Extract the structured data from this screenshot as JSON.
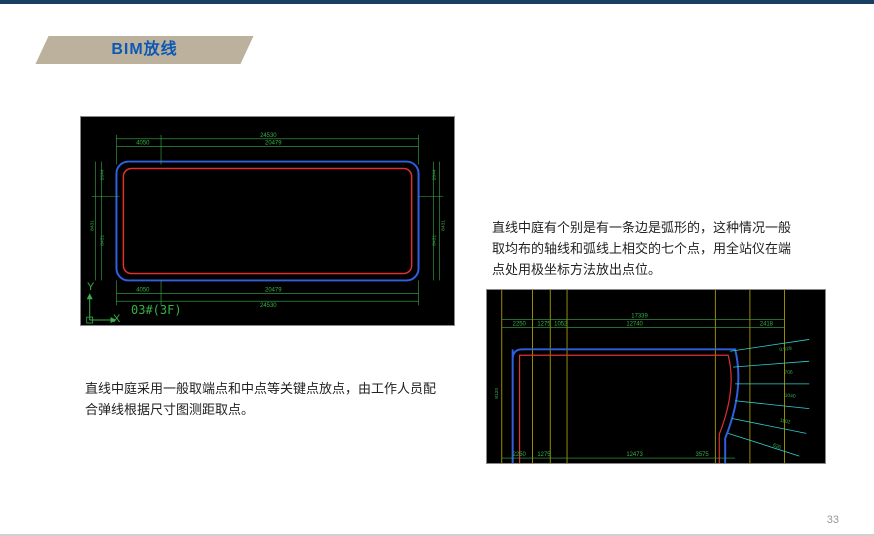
{
  "slide": {
    "title": "BIM放线",
    "page_number": "33"
  },
  "captions": {
    "left": "直线中庭采用一般取端点和中点等关键点放点，由工作人员配合弹线根据尺寸图测距取点。",
    "right": "直线中庭有个别是有一条边是弧形的，这种情况一般取均布的轴线和弧线上相交的七个点，用全站仪在端点处用极坐标方法放出点位。"
  },
  "figure1": {
    "label": "03#(3F)",
    "axis_y": "Y",
    "axis_x": "X",
    "axis_arrow": "↗",
    "dims_top": [
      "4050",
      "20479",
      "24530"
    ],
    "dims_bottom": [
      "4050",
      "20479",
      "24530"
    ],
    "dims_left": [
      "2644",
      "8431",
      "8431"
    ],
    "dims_right": [
      "2644",
      "8431",
      "8431"
    ]
  },
  "figure2": {
    "dims_top": [
      "2250",
      "1275",
      "1052",
      "17339",
      "12740",
      "2418"
    ],
    "dims_bottom": [
      "2250",
      "1275",
      "12473",
      "3575"
    ],
    "dims_right": [
      "0.529",
      "706",
      "1040",
      "1102",
      "626"
    ]
  },
  "colors": {
    "accent": "#bcb19d",
    "title": "#0b58b5",
    "bar": "#183f63",
    "cad_green": "#38b048",
    "cad_red": "#e03030",
    "cad_blue": "#3060e0",
    "cad_yellow": "#c0b000",
    "cad_cyan": "#30d0d0"
  }
}
